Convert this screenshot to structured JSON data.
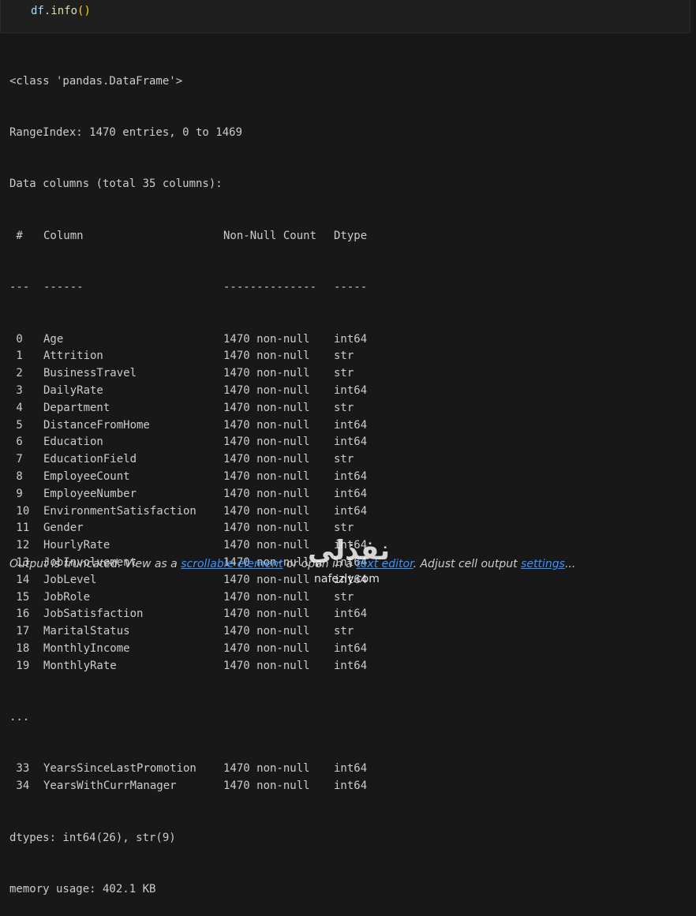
{
  "cell": {
    "code_var": "df",
    "code_dot": ".",
    "code_fn": "info",
    "code_paren": "()"
  },
  "output": {
    "class_line": "<class 'pandas.DataFrame'>",
    "range_index": "RangeIndex: 1470 entries, 0 to 1469",
    "data_columns": "Data columns (total 35 columns):",
    "header": {
      "num": " #",
      "column": "Column",
      "count": "Non-Null Count",
      "dtype": "Dtype"
    },
    "separator": {
      "num": "---",
      "column": "------",
      "count": "--------------",
      "dtype": "-----"
    },
    "rows": [
      {
        "num": " 0",
        "column": "Age",
        "count": "1470 non-null",
        "dtype": "int64"
      },
      {
        "num": " 1",
        "column": "Attrition",
        "count": "1470 non-null",
        "dtype": "str"
      },
      {
        "num": " 2",
        "column": "BusinessTravel",
        "count": "1470 non-null",
        "dtype": "str"
      },
      {
        "num": " 3",
        "column": "DailyRate",
        "count": "1470 non-null",
        "dtype": "int64"
      },
      {
        "num": " 4",
        "column": "Department",
        "count": "1470 non-null",
        "dtype": "str"
      },
      {
        "num": " 5",
        "column": "DistanceFromHome",
        "count": "1470 non-null",
        "dtype": "int64"
      },
      {
        "num": " 6",
        "column": "Education",
        "count": "1470 non-null",
        "dtype": "int64"
      },
      {
        "num": " 7",
        "column": "EducationField",
        "count": "1470 non-null",
        "dtype": "str"
      },
      {
        "num": " 8",
        "column": "EmployeeCount",
        "count": "1470 non-null",
        "dtype": "int64"
      },
      {
        "num": " 9",
        "column": "EmployeeNumber",
        "count": "1470 non-null",
        "dtype": "int64"
      },
      {
        "num": " 10",
        "column": "EnvironmentSatisfaction",
        "count": "1470 non-null",
        "dtype": "int64"
      },
      {
        "num": " 11",
        "column": "Gender",
        "count": "1470 non-null",
        "dtype": "str"
      },
      {
        "num": " 12",
        "column": "HourlyRate",
        "count": "1470 non-null",
        "dtype": "int64"
      },
      {
        "num": " 13",
        "column": "JobInvolvement",
        "count": "1470 non-null",
        "dtype": "int64"
      },
      {
        "num": " 14",
        "column": "JobLevel",
        "count": "1470 non-null",
        "dtype": "int64"
      },
      {
        "num": " 15",
        "column": "JobRole",
        "count": "1470 non-null",
        "dtype": "str"
      },
      {
        "num": " 16",
        "column": "JobSatisfaction",
        "count": "1470 non-null",
        "dtype": "int64"
      },
      {
        "num": " 17",
        "column": "MaritalStatus",
        "count": "1470 non-null",
        "dtype": "str"
      },
      {
        "num": " 18",
        "column": "MonthlyIncome",
        "count": "1470 non-null",
        "dtype": "int64"
      },
      {
        "num": " 19",
        "column": "MonthlyRate",
        "count": "1470 non-null",
        "dtype": "int64"
      }
    ],
    "ellipsis": "...",
    "tail_rows": [
      {
        "num": " 33",
        "column": "YearsSinceLastPromotion",
        "count": "1470 non-null",
        "dtype": "int64"
      },
      {
        "num": " 34",
        "column": "YearsWithCurrManager",
        "count": "1470 non-null",
        "dtype": "int64"
      }
    ],
    "dtypes": "dtypes: int64(26), str(9)",
    "memory": "memory usage: 402.1 KB"
  },
  "truncation": {
    "prefix": "Output is truncated. View as a ",
    "link1": "scrollable element",
    "middle": " or open in a ",
    "link2": "text editor",
    "middle2": ". Adjust cell output ",
    "link3": "settings",
    "suffix": "..."
  },
  "watermark": {
    "arabic": "نفذلي",
    "url": "nafezly.com"
  },
  "colors": {
    "background": "#181818",
    "text": "#cccccc",
    "link": "#3794ff",
    "code_var": "#9cdcfe",
    "code_fn": "#dcdcaa",
    "code_paren": "#ffd700"
  }
}
